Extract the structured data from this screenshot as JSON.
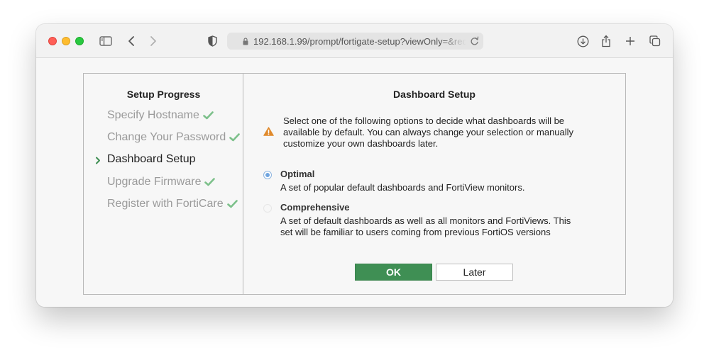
{
  "browser": {
    "url": "192.168.1.99/prompt/fortigate-setup?viewOnly=&redirect=..."
  },
  "sidebar": {
    "title": "Setup Progress",
    "steps": [
      {
        "label": "Specify Hostname",
        "state": "done"
      },
      {
        "label": "Change Your Password",
        "state": "done"
      },
      {
        "label": "Dashboard Setup",
        "state": "current"
      },
      {
        "label": "Upgrade Firmware",
        "state": "done"
      },
      {
        "label": "Register with FortiCare",
        "state": "done"
      }
    ]
  },
  "main": {
    "title": "Dashboard Setup",
    "info_text": "Select one of the following options to decide what dashboards will be available by default. You can always change your selection or manually customize your own dashboards later.",
    "options": [
      {
        "label": "Optimal",
        "description": "A set of popular default dashboards and FortiView monitors.",
        "selected": true
      },
      {
        "label": "Comprehensive",
        "description": "A set of default dashboards as well as all monitors and FortiViews. This set will be familiar to users coming from previous FortiOS versions",
        "selected": false
      }
    ],
    "ok_label": "OK",
    "later_label": "Later"
  },
  "colors": {
    "accent_green": "#3f8f54",
    "check_green": "#7cc08a",
    "warning_orange": "#e08a2c",
    "radio_blue": "#6ea4df"
  }
}
